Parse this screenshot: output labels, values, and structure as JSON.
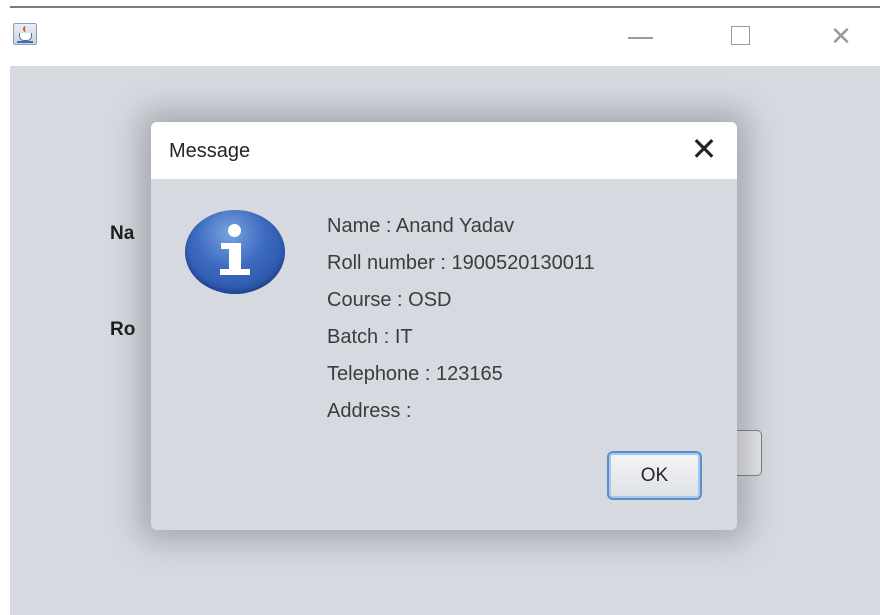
{
  "window": {
    "controls": {
      "minimize": "—",
      "maximize": "□",
      "close": "✕"
    },
    "icon": "java-app-icon"
  },
  "background_form": {
    "labels": [
      "Na",
      "Ro"
    ]
  },
  "dialog": {
    "title": "Message",
    "close_glyph": "✕",
    "icon": "information-icon",
    "lines": [
      "Name : Anand Yadav",
      "Roll number : 1900520130011",
      "Course : OSD",
      "Batch : IT",
      "Telephone : 123165",
      "Address :"
    ],
    "ok_label": "OK"
  },
  "colors": {
    "panel_background": "#d6d9e0",
    "icon_blue": "#3d6bc0",
    "ok_border": "#5a8fc9"
  }
}
